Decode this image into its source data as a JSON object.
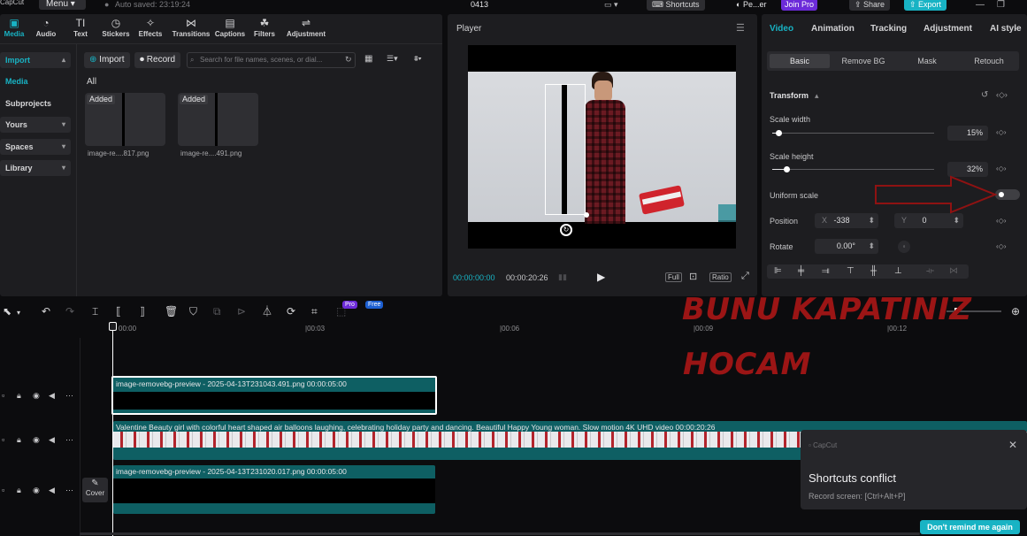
{
  "titlebar": {
    "app_name": "CapCut",
    "menu_label": "Menu",
    "autosave_text": "Auto saved: 23:19:24",
    "project_name": "0413",
    "shortcuts_label": "Shortcuts",
    "user_name": "Pe...er",
    "join_pro_label": "Join Pro",
    "share_label": "Share",
    "export_label": "Export"
  },
  "media_tabs": [
    {
      "label": "Media",
      "icon": "media-icon"
    },
    {
      "label": "Audio",
      "icon": "audio-icon"
    },
    {
      "label": "Text",
      "icon": "text-icon"
    },
    {
      "label": "Stickers",
      "icon": "stickers-icon"
    },
    {
      "label": "Effects",
      "icon": "effects-icon"
    },
    {
      "label": "Transitions",
      "icon": "transitions-icon"
    },
    {
      "label": "Captions",
      "icon": "captions-icon"
    },
    {
      "label": "Filters",
      "icon": "filters-icon"
    },
    {
      "label": "Adjustment",
      "icon": "adjustment-icon"
    }
  ],
  "sidebar": {
    "items": [
      {
        "label": "Import"
      },
      {
        "label": "Media"
      },
      {
        "label": "Subprojects"
      },
      {
        "label": "Yours"
      },
      {
        "label": "Spaces"
      },
      {
        "label": "Library"
      }
    ]
  },
  "media": {
    "import_label": "Import",
    "record_label": "Record",
    "search_placeholder": "Search for file names, scenes, or dial...",
    "filter_label": "All",
    "items": [
      {
        "tag": "Added",
        "name": "image-re....817.png"
      },
      {
        "tag": "Added",
        "name": "image-re....491.png"
      }
    ]
  },
  "player": {
    "title": "Player",
    "current_time": "00:00:00:00",
    "total_time": "00:00:20:26",
    "full_label": "Full",
    "ratio_label": "Ratio"
  },
  "inspector": {
    "tabs": [
      "Video",
      "Animation",
      "Tracking",
      "Adjustment",
      "AI style"
    ],
    "subtabs": [
      "Basic",
      "Remove BG",
      "Mask",
      "Retouch"
    ],
    "section_title": "Transform",
    "scale_width_label": "Scale width",
    "scale_width_value": "15%",
    "scale_width_fraction": 0.15,
    "scale_height_label": "Scale height",
    "scale_height_value": "32%",
    "scale_height_fraction": 0.32,
    "uniform_scale_label": "Uniform scale",
    "uniform_scale_on": false,
    "position_label": "Position",
    "x_label": "X",
    "x_value": "-338",
    "y_label": "Y",
    "y_value": "0",
    "rotate_label": "Rotate",
    "rotate_value": "0.00°"
  },
  "timeline": {
    "ruler": [
      "00:00",
      "00:03",
      "00:06",
      "00:09",
      "00:12"
    ],
    "pro_badge": "Pro",
    "free_badge": "Free",
    "cover_label": "Cover",
    "clips": [
      {
        "label": "image-removebg-preview - 2025-04-13T231043.491.png  00:00:05:00"
      },
      {
        "label": "Valentine Beauty girl with colorful heart shaped air balloons laughing, celebrating holiday party and dancing. Beautiful Happy Young woman. Slow motion 4K UHD video  00:00:20:26"
      },
      {
        "label": "image-removebg-preview - 2025-04-13T231020.017.png  00:00:05:00"
      }
    ]
  },
  "annotation": {
    "line1": "BUNU KAPATINIZ",
    "line2": "HOCAM",
    "color": "#9b1515"
  },
  "toast": {
    "app": "CapCut",
    "title": "Shortcuts conflict",
    "body": "Record screen: [Ctrl+Alt+P]",
    "dont_remind_label": "Don't remind me again"
  },
  "colors": {
    "accent": "#18b3c4",
    "panel": "#1d1d20",
    "background": "#0c0c0e"
  }
}
